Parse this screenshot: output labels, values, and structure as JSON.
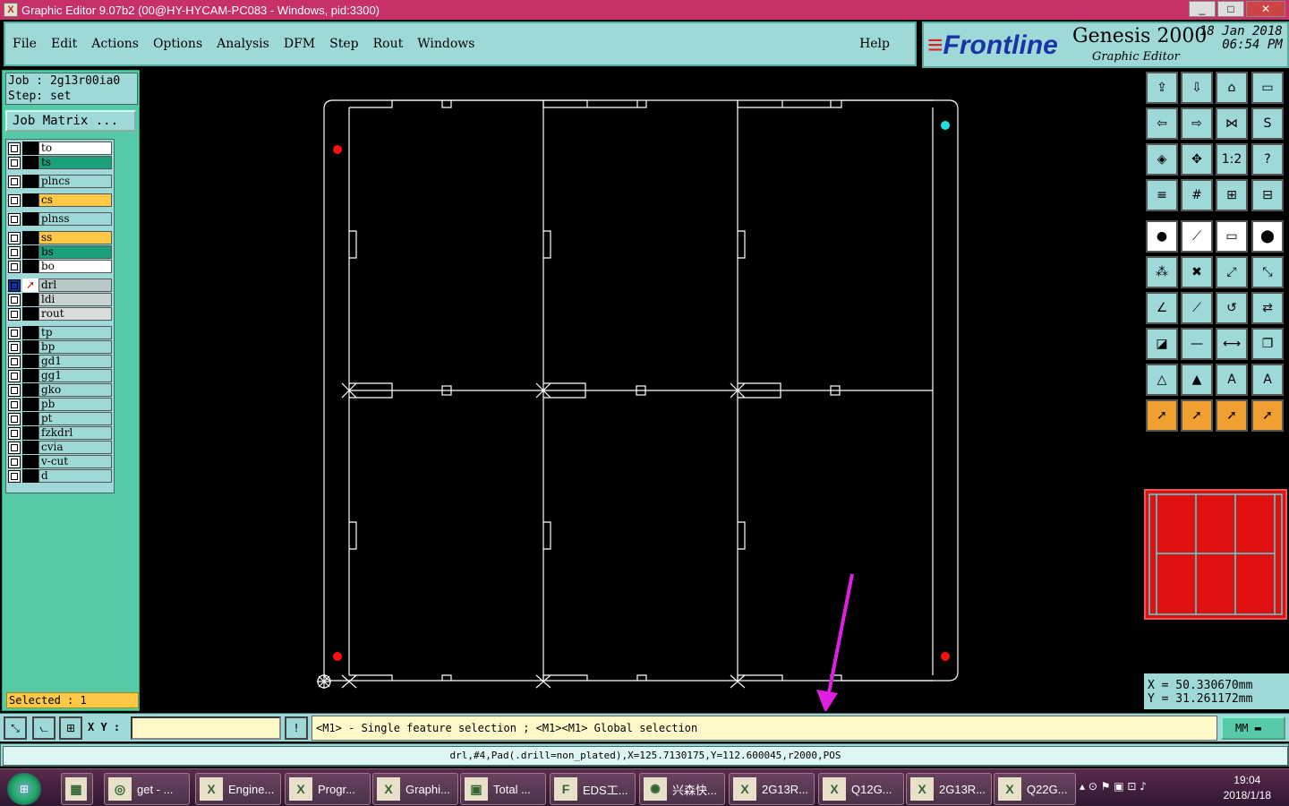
{
  "window": {
    "title": "Graphic Editor 9.07b2 (00@HY-HYCAM-PC083 - Windows, pid:3300)",
    "min": "_",
    "max": "□",
    "close": "✕"
  },
  "menu": {
    "items": [
      "File",
      "Edit",
      "Actions",
      "Options",
      "Analysis",
      "DFM",
      "Step",
      "Rout",
      "Windows"
    ],
    "help": "Help"
  },
  "brand": {
    "logo": "Frontline",
    "product": "Genesis 2000",
    "subtitle": "Graphic Editor",
    "date": "18 Jan 2018",
    "time": "06:54 PM"
  },
  "job": {
    "line1": "Job : 2g13r00ia0",
    "line2": "Step: set",
    "matrix_button": "Job Matrix ..."
  },
  "layers": [
    {
      "name": "to",
      "color": "#ffffff"
    },
    {
      "name": "ts",
      "color": "#1aa07a"
    },
    {
      "name": "plncs",
      "color": "#9ed9d8"
    },
    {
      "name": "cs",
      "color": "#ffc845"
    },
    {
      "name": "plnss",
      "color": "#9ed9d8"
    },
    {
      "name": "ss",
      "color": "#ffc845"
    },
    {
      "name": "bs",
      "color": "#1aa07a"
    },
    {
      "name": "bo",
      "color": "#ffffff"
    },
    {
      "name": "drl",
      "color": "#b8c8c8",
      "active": true
    },
    {
      "name": "ldi",
      "color": "#c8d4d4"
    },
    {
      "name": "rout",
      "color": "#d8dede"
    },
    {
      "name": "tp",
      "color": "#9ed9d8"
    },
    {
      "name": "bp",
      "color": "#9ed9d8"
    },
    {
      "name": "gd1",
      "color": "#9ed9d8"
    },
    {
      "name": "gg1",
      "color": "#9ed9d8"
    },
    {
      "name": "gko",
      "color": "#9ed9d8"
    },
    {
      "name": "pb",
      "color": "#9ed9d8"
    },
    {
      "name": "pt",
      "color": "#9ed9d8"
    },
    {
      "name": "fzkdrl",
      "color": "#9ed9d8"
    },
    {
      "name": "cvia",
      "color": "#9ed9d8"
    },
    {
      "name": "v-cut",
      "color": "#9ed9d8"
    },
    {
      "name": "d",
      "color": "#9ed9d8"
    }
  ],
  "selected": "Selected : 1",
  "coords": {
    "x": "X = 50.330670mm",
    "y": "Y = 31.261172mm"
  },
  "cmd": {
    "xy_label": "X Y :",
    "xy_value": "",
    "excl": "!",
    "message": "<M1> - Single feature selection ; <M1><M1> Global selection",
    "units": "MM"
  },
  "info": "drl,#4,Pad(.drill=non_plated),X=125.7130175,Y=112.600045,r2000,POS",
  "taskbar": {
    "tasks": [
      "get - ...",
      "Engine...",
      "Progr...",
      "Graphi...",
      "Total ...",
      "EDS工...",
      "兴森快...",
      "2G13R...",
      "Q12G...",
      "2G13R...",
      "Q22G..."
    ],
    "time": "19:04",
    "date": "2018/1/18"
  },
  "colors": {
    "panel": "#9ed9d8",
    "teal": "#55c9a8",
    "board_outline": "#ffffff",
    "fiducial": "#ff1010",
    "marker_cyan": "#20e0e0",
    "arrow": "#e020e0"
  }
}
